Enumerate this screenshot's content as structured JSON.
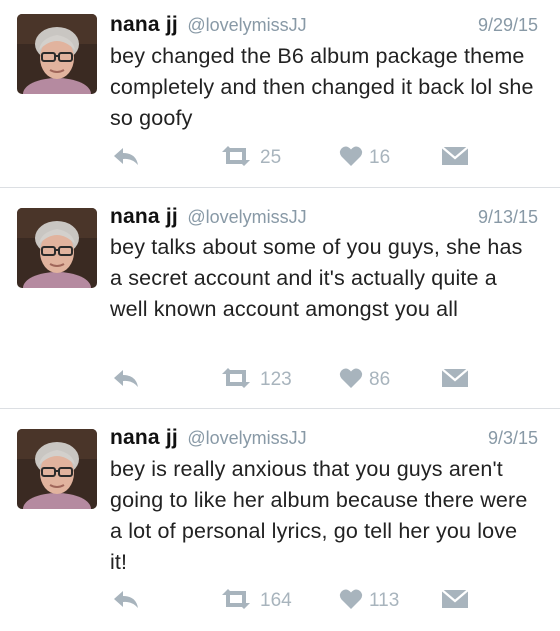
{
  "colors": {
    "name": "#111111",
    "meta_gray": "#8899a6",
    "action_gray": "#a8b4bd",
    "divider": "#dcdfe3"
  },
  "tweets": [
    {
      "name": "nana jj",
      "handle": "@lovelymissJJ",
      "date": "9/29/15",
      "text": "bey changed the B6 album package theme completely and then changed it back lol she so goofy",
      "retweets": "25",
      "likes": "16",
      "icons": [
        "reply-icon",
        "retweet-icon",
        "heart-icon",
        "direct-message-icon"
      ]
    },
    {
      "name": "nana jj",
      "handle": "@lovelymissJJ",
      "date": "9/13/15",
      "text": "bey talks about some of you guys, she has a secret account and it's actually quite a well known account amongst you all",
      "retweets": "123",
      "likes": "86",
      "icons": [
        "reply-icon",
        "retweet-icon",
        "heart-icon",
        "direct-message-icon"
      ]
    },
    {
      "name": "nana jj",
      "handle": "@lovelymissJJ",
      "date": "9/3/15",
      "text": "bey is really anxious that you guys aren't going to like her album because there were a lot of personal lyrics, go tell her you love it!",
      "retweets": "164",
      "likes": "113",
      "icons": [
        "reply-icon",
        "retweet-icon",
        "heart-icon",
        "direct-message-icon"
      ]
    }
  ]
}
